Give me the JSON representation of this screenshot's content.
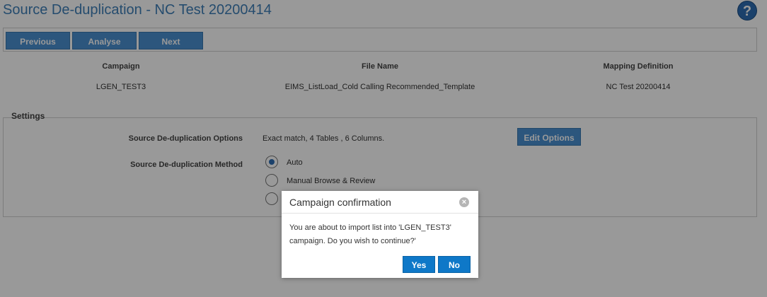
{
  "header": {
    "title": "Source De-duplication - NC Test 20200414",
    "help_icon": "?"
  },
  "toolbar": {
    "previous_label": "Previous",
    "analyse_label": "Analyse",
    "next_label": "Next"
  },
  "summary": {
    "columns": [
      {
        "header": "Campaign",
        "value": "LGEN_TEST3"
      },
      {
        "header": "File Name",
        "value": "EIMS_ListLoad_Cold Calling Recommended_Template"
      },
      {
        "header": "Mapping Definition",
        "value": "NC Test 20200414"
      }
    ]
  },
  "settings": {
    "legend": "Settings",
    "options_label": "Source De-duplication Options",
    "options_value": "Exact match, 4 Tables , 6 Columns.",
    "edit_options_label": "Edit Options",
    "method_label": "Source De-duplication Method",
    "methods": [
      {
        "label": "Auto",
        "selected": true
      },
      {
        "label": "Manual Browse & Review",
        "selected": false
      },
      {
        "label": "",
        "selected": false
      }
    ]
  },
  "dialog": {
    "title": "Campaign confirmation",
    "close_icon": "×",
    "message": "You are about to import list into 'LGEN_TEST3' campaign. Do you wish to continue?'",
    "yes_label": "Yes",
    "no_label": "No"
  },
  "colors": {
    "title": "#3f7fb8",
    "button": "#4a8fd0",
    "dialog_button": "#0e78c8"
  }
}
